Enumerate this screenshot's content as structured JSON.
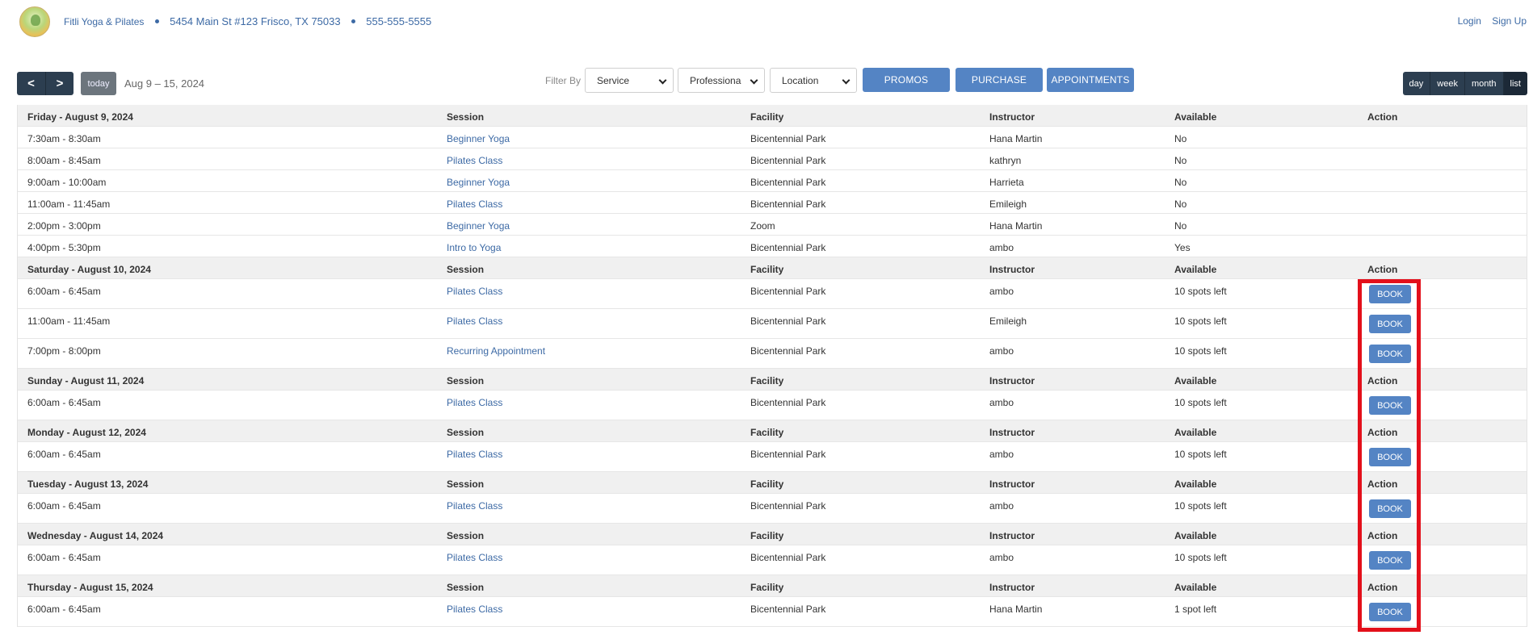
{
  "header": {
    "business_name": "Fitli Yoga & Pilates",
    "address": "5454 Main St #123 Frisco, TX 75033",
    "phone": "555-555-5555",
    "login": "Login",
    "signup": "Sign Up"
  },
  "toolbar": {
    "prev_icon": "<",
    "next_icon": ">",
    "today": "today",
    "date_range": "Aug 9 – 15, 2024",
    "filter_label": "Filter By",
    "service_select": "Service",
    "professional_select": "Professiona",
    "location_select": "Location",
    "promos": "PROMOS",
    "purchase": "PURCHASE",
    "appointments": "APPOINTMENTS",
    "views": [
      "day",
      "week",
      "month",
      "list"
    ]
  },
  "columns": {
    "session": "Session",
    "facility": "Facility",
    "instructor": "Instructor",
    "available": "Available",
    "action": "Action"
  },
  "days": [
    {
      "label": "Friday - August 9, 2024",
      "rows": [
        {
          "time": "7:30am - 8:30am",
          "session": "Beginner Yoga",
          "facility": "Bicentennial Park",
          "instructor": "Hana Martin",
          "available": "No",
          "action": ""
        },
        {
          "time": "8:00am - 8:45am",
          "session": "Pilates Class",
          "facility": "Bicentennial Park",
          "instructor": "kathryn",
          "available": "No",
          "action": ""
        },
        {
          "time": "9:00am - 10:00am",
          "session": "Beginner Yoga",
          "facility": "Bicentennial Park",
          "instructor": "Harrieta",
          "available": "No",
          "action": ""
        },
        {
          "time": "11:00am - 11:45am",
          "session": "Pilates Class",
          "facility": "Bicentennial Park",
          "instructor": "Emileigh",
          "available": "No",
          "action": ""
        },
        {
          "time": "2:00pm - 3:00pm",
          "session": "Beginner Yoga",
          "facility": "Zoom",
          "instructor": "Hana Martin",
          "available": "No",
          "action": ""
        },
        {
          "time": "4:00pm - 5:30pm",
          "session": "Intro to Yoga",
          "facility": "Bicentennial Park",
          "instructor": "ambo",
          "available": "Yes",
          "action": ""
        }
      ]
    },
    {
      "label": "Saturday - August 10, 2024",
      "rows": [
        {
          "time": "6:00am - 6:45am",
          "session": "Pilates Class",
          "facility": "Bicentennial Park",
          "instructor": "ambo",
          "available": "10 spots left",
          "action": "BOOK"
        },
        {
          "time": "11:00am - 11:45am",
          "session": "Pilates Class",
          "facility": "Bicentennial Park",
          "instructor": "Emileigh",
          "available": "10 spots left",
          "action": "BOOK"
        },
        {
          "time": "7:00pm - 8:00pm",
          "session": "Recurring Appointment",
          "facility": "Bicentennial Park",
          "instructor": "ambo",
          "available": "10 spots left",
          "action": "BOOK"
        }
      ]
    },
    {
      "label": "Sunday - August 11, 2024",
      "rows": [
        {
          "time": "6:00am - 6:45am",
          "session": "Pilates Class",
          "facility": "Bicentennial Park",
          "instructor": "ambo",
          "available": "10 spots left",
          "action": "BOOK"
        }
      ]
    },
    {
      "label": "Monday - August 12, 2024",
      "rows": [
        {
          "time": "6:00am - 6:45am",
          "session": "Pilates Class",
          "facility": "Bicentennial Park",
          "instructor": "ambo",
          "available": "10 spots left",
          "action": "BOOK"
        }
      ]
    },
    {
      "label": "Tuesday - August 13, 2024",
      "rows": [
        {
          "time": "6:00am - 6:45am",
          "session": "Pilates Class",
          "facility": "Bicentennial Park",
          "instructor": "ambo",
          "available": "10 spots left",
          "action": "BOOK"
        }
      ]
    },
    {
      "label": "Wednesday - August 14, 2024",
      "rows": [
        {
          "time": "6:00am - 6:45am",
          "session": "Pilates Class",
          "facility": "Bicentennial Park",
          "instructor": "ambo",
          "available": "10 spots left",
          "action": "BOOK"
        }
      ]
    },
    {
      "label": "Thursday - August 15, 2024",
      "rows": [
        {
          "time": "6:00am - 6:45am",
          "session": "Pilates Class",
          "facility": "Bicentennial Park",
          "instructor": "Hana Martin",
          "available": "1 spot left",
          "action": "BOOK"
        }
      ]
    }
  ],
  "colors": {
    "nav_dark": "#2c3e50",
    "accent_blue": "#5484c4",
    "link_blue": "#3d6aa5",
    "highlight_red": "#e3101b"
  }
}
